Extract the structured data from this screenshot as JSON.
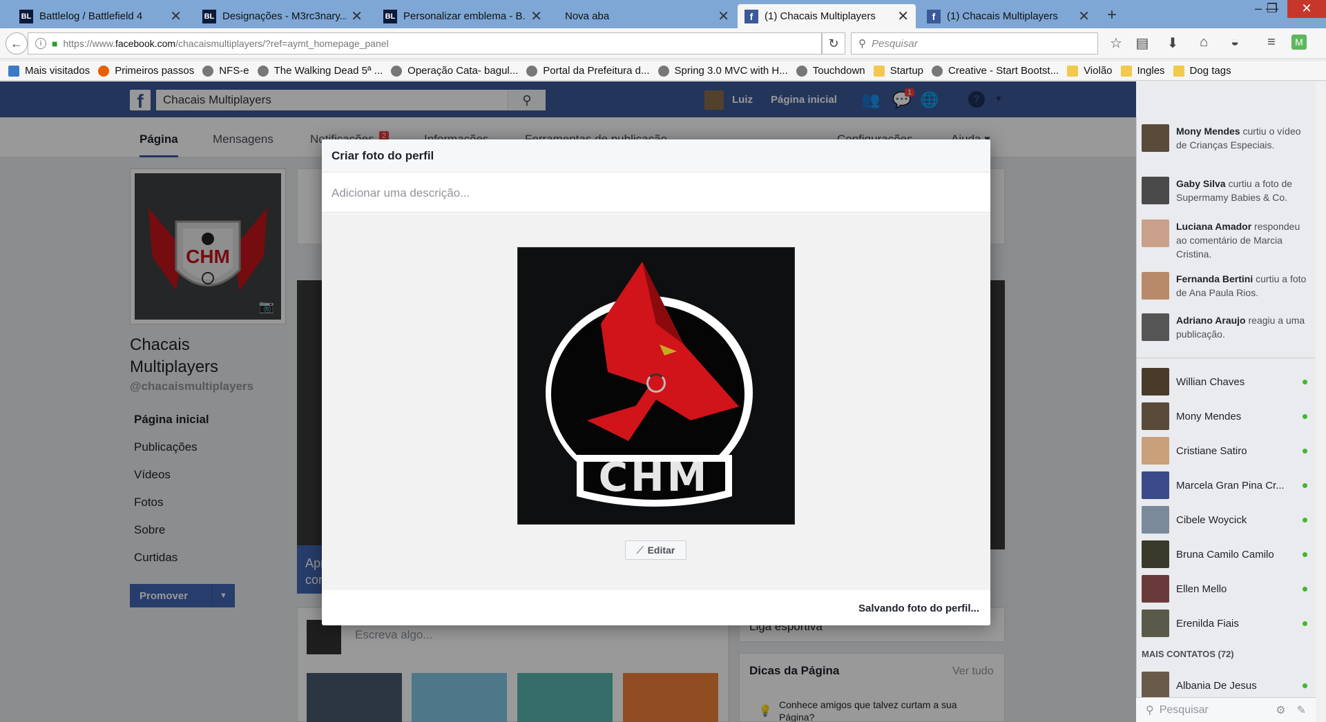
{
  "browser": {
    "tabs": [
      {
        "title": "Battlelog / Battlefield 4",
        "icon": "battlelog-icon"
      },
      {
        "title": "Designações - M3rc3nary...",
        "icon": "battlelog-icon"
      },
      {
        "title": "Personalizar emblema - B...",
        "icon": "battlelog-icon"
      },
      {
        "title": "Nova aba",
        "icon": ""
      },
      {
        "title": "(1) Chacais Multiplayers",
        "icon": "facebook-icon",
        "active": true
      },
      {
        "title": "(1) Chacais Multiplayers",
        "icon": "facebook-icon"
      }
    ],
    "url_prefix": "https://www.",
    "url_domain": "facebook.com",
    "url_suffix": "/chacaismultiplayers/?ref=aymt_homepage_panel",
    "search_placeholder": "Pesquisar",
    "bookmarks": [
      {
        "label": "Mais visitados",
        "type": "special"
      },
      {
        "label": "Primeiros passos",
        "type": "firefox"
      },
      {
        "label": "NFS-e",
        "type": "globe"
      },
      {
        "label": "The Walking Dead 5ª ...",
        "type": "globe"
      },
      {
        "label": "Operação Cata- bagul...",
        "type": "globe"
      },
      {
        "label": "Portal da Prefeitura d...",
        "type": "globe"
      },
      {
        "label": "Spring 3.0 MVC with H...",
        "type": "globe"
      },
      {
        "label": "Touchdown",
        "type": "globe"
      },
      {
        "label": "Startup",
        "type": "folder"
      },
      {
        "label": "Creative - Start Bootst...",
        "type": "globe"
      },
      {
        "label": "Violão",
        "type": "folder"
      },
      {
        "label": "Ingles",
        "type": "folder"
      },
      {
        "label": "Dog tags",
        "type": "folder"
      }
    ]
  },
  "fb": {
    "search_value": "Chacais Multiplayers",
    "user_name": "Luiz",
    "home_label": "Página inicial",
    "messages_badge": "1",
    "page_tabs": [
      "Página",
      "Mensagens",
      "Notificações",
      "Informações",
      "Ferramentas de publicação",
      "Configurações",
      "Ajuda ▾"
    ],
    "notif_badge": "2",
    "page_name": "Chacais Multiplayers",
    "page_handle": "@chacaismultiplayers",
    "left_nav": [
      "Página inicial",
      "Publicações",
      "Vídeos",
      "Fotos",
      "Sobre",
      "Curtidas"
    ],
    "promote_label": "Promover",
    "composer_placeholder": "Escreva algo...",
    "bg_text_liga": "Liga esportiva",
    "tips_title": "Dicas da Página",
    "tips_link": "Ver tudo",
    "tips_item": "Conhece amigos que talvez curtam a sua Página?",
    "blue_card_text_1": "Apr",
    "blue_card_text_2": "con"
  },
  "chat": {
    "notifications": [
      {
        "name": "Mony Mendes",
        "text": " curtiu o vídeo de Crianças Especiais."
      },
      {
        "name": "Gaby Silva",
        "text": " curtiu a foto de Supermamy Babies & Co."
      },
      {
        "name": "Luciana Amador",
        "text": " respondeu ao comentário de Marcia Cristina."
      },
      {
        "name": "Fernanda Bertini",
        "text": " curtiu a foto de Ana Paula Rios."
      },
      {
        "name": "Adriano Araujo",
        "text": " reagiu a uma publicação."
      }
    ],
    "contacts": [
      "Willian Chaves",
      "Mony Mendes",
      "Cristiane Satiro",
      "Marcela Gran Pina Cr...",
      "Cibele Woycick",
      "Bruna Camilo Camilo",
      "Ellen Mello",
      "Erenilda Fiais"
    ],
    "more_contacts_label": "MAIS CONTATOS (72)",
    "more_contacts": [
      "Albania De Jesus"
    ],
    "search_placeholder": "Pesquisar"
  },
  "modal": {
    "title": "Criar foto do perfil",
    "description_placeholder": "Adicionar uma descrição...",
    "edit_label": "Editar",
    "status": "Salvando foto do perfil...",
    "logo_text": "CHM"
  },
  "profile_logo_text": "CHM",
  "colors": {
    "fb_blue": "#3b5998",
    "logo_red": "#d0141a",
    "online_green": "#42b72a"
  }
}
